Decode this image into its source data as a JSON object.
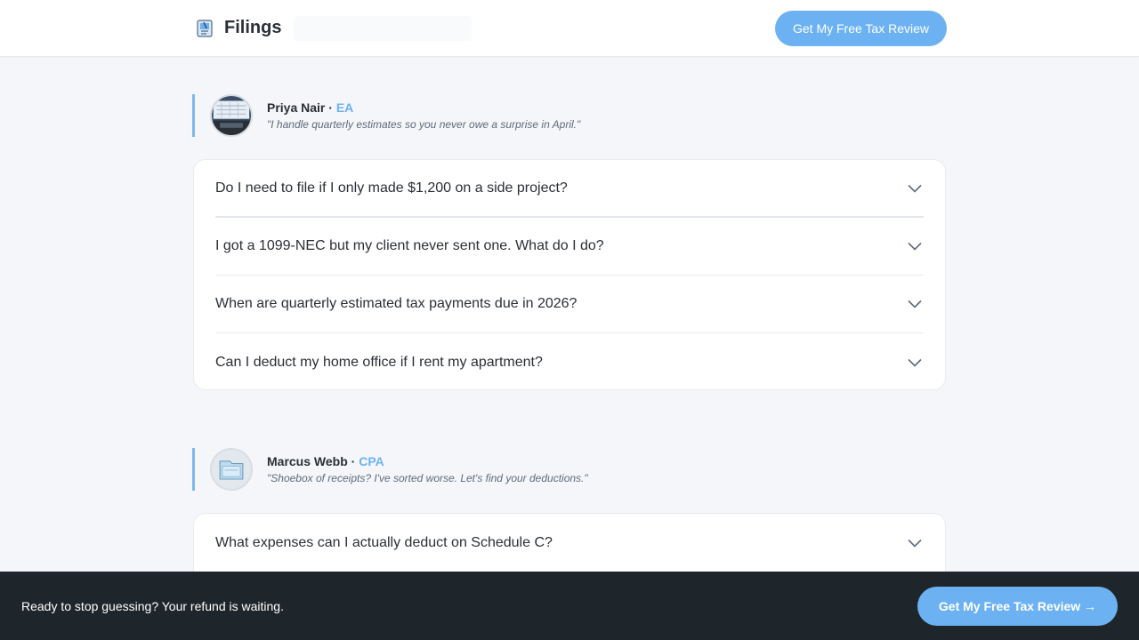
{
  "header": {
    "brand": "Filings",
    "cta_label": "Get My Free Tax Review"
  },
  "experts": [
    {
      "name": "Priya Nair",
      "separator": "·",
      "credential": "EA",
      "quote": "\"I handle quarterly estimates so you never owe a surprise in April.\"",
      "faqs": [
        "Do I need to file if I only made $1,200 on a side project?",
        "I got a 1099-NEC but my client never sent one. What do I do?",
        "When are quarterly estimated tax payments due in 2026?",
        "Can I deduct my home office if I rent my apartment?"
      ]
    },
    {
      "name": "Marcus Webb",
      "separator": "·",
      "credential": "CPA",
      "quote": "\"Shoebox of receipts? I've sorted worse. Let's find your deductions.\"",
      "faqs": [
        "What expenses can I actually deduct on Schedule C?"
      ]
    }
  ],
  "footer": {
    "message": "Ready to stop guessing? Your refund is waiting.",
    "cta_label": "Get My Free Tax Review →"
  },
  "colors": {
    "accent": "#6cb2f2",
    "footer_bg": "#1f262b",
    "page_bg": "#f4f6f9"
  },
  "icons": {
    "brand": "document-logo-icon",
    "faq_toggle": "chevron-down-icon"
  }
}
